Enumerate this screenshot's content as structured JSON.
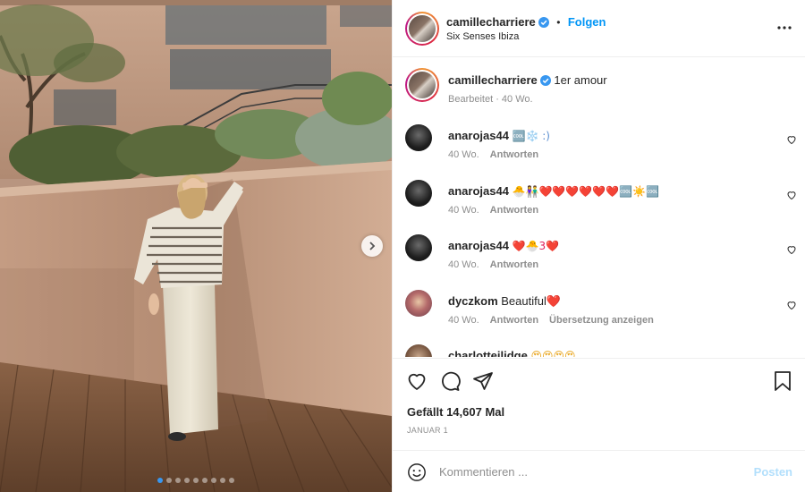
{
  "post": {
    "author": "camillecharriere",
    "follow_label": "Folgen",
    "separator": "•",
    "location": "Six Senses Ibiza",
    "caption": "1er amour",
    "caption_meta": "Bearbeitet · 40 Wo.",
    "carousel": {
      "total": 9,
      "active_index": 0
    }
  },
  "comments": [
    {
      "user": "anarojas44",
      "text": "🆒❄️ :)",
      "time": "40 Wo.",
      "reply": "Antworten"
    },
    {
      "user": "anarojas44",
      "text": "🐣👫❤️❤️❤️❤️❤️❤️🆒☀️🆒",
      "time": "40 Wo.",
      "reply": "Antworten"
    },
    {
      "user": "anarojas44",
      "text": "❤️🐣3❤️",
      "time": "40 Wo.",
      "reply": "Antworten"
    },
    {
      "user": "dyczkom",
      "text": "Beautiful❤️",
      "time": "40 Wo.",
      "reply": "Antworten",
      "translate": "Übersetzung anzeigen"
    },
    {
      "user": "charlotteilidge",
      "text": "😍😍😍😍"
    }
  ],
  "likes_text": "Gefällt 14,607 Mal",
  "date_text": "JANUAR 1",
  "comment_box": {
    "placeholder": "Kommentieren ...",
    "post_label": "Posten"
  },
  "icons": {
    "more": "more-horizontal-icon",
    "like": "heart-outline-icon",
    "comment": "comment-bubble-icon",
    "share": "paper-plane-icon",
    "save": "bookmark-icon",
    "emoji": "smiley-icon",
    "next": "chevron-right-icon",
    "verified": "verified-badge-icon"
  },
  "colors": {
    "accent": "#0095f6",
    "post_disabled": "#b2dffc",
    "muted": "#8e8e8e"
  }
}
